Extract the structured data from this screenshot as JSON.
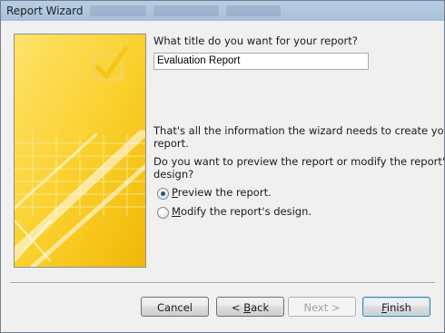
{
  "window": {
    "title": "Report Wizard"
  },
  "wizard": {
    "title_prompt": "What title do you want for your report?",
    "title_value": "Evaluation Report",
    "info_line1": "That's all the information the wizard needs to create your",
    "info_line2": "report.",
    "question_line1": "Do you want to preview the report or modify the report's",
    "question_line2": "design?",
    "options": [
      {
        "label_prefix": "",
        "label_accel": "P",
        "label_rest": "review the report.",
        "selected": true
      },
      {
        "label_prefix": "",
        "label_accel": "M",
        "label_rest": "odify the report's design.",
        "selected": false
      }
    ]
  },
  "buttons": {
    "cancel": "Cancel",
    "back_prefix": "< ",
    "back_accel": "B",
    "back_rest": "ack",
    "next": "Next >",
    "finish_accel": "F",
    "finish_rest": "inish"
  },
  "colors": {
    "panel_yellow": "#f5c518",
    "panel_light": "#fde98a",
    "default_button_border": "#3c7fb1"
  },
  "icons": {
    "art": "checkbox-checkmark-decoration"
  }
}
